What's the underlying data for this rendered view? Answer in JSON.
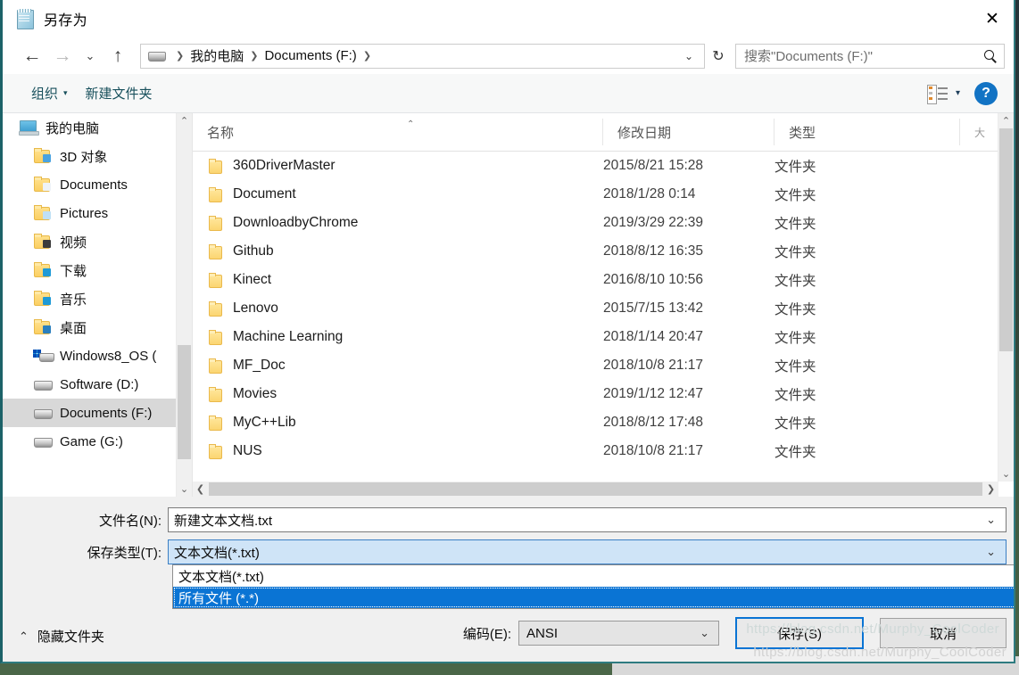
{
  "window": {
    "title": "另存为",
    "title_icon": "notepad-icon",
    "close_label": "✕"
  },
  "nav": {
    "back_label": "←",
    "forward_label": "→",
    "recent_label": "⌄",
    "up_label": "↑",
    "refresh_label": "↻",
    "breadcrumb": {
      "drive_icon": "drive-icon",
      "separator": "❯",
      "items": [
        "我的电脑",
        "Documents (F:)"
      ],
      "caret": "⌄"
    }
  },
  "search": {
    "placeholder": "搜索\"Documents (F:)\"",
    "icon": "search-icon"
  },
  "toolbar": {
    "organize_label": "组织",
    "organize_caret": "▾",
    "new_folder_label": "新建文件夹",
    "view_icon": "list-view-icon",
    "view_caret": "▾",
    "help_label": "?"
  },
  "sidebar": {
    "items": [
      {
        "label": "我的电脑",
        "icon": "computer-icon",
        "indent": false,
        "selected": false
      },
      {
        "label": "3D 对象",
        "icon": "folder-3d-icon",
        "indent": true,
        "selected": false
      },
      {
        "label": "Documents",
        "icon": "folder-documents-icon",
        "indent": true,
        "selected": false
      },
      {
        "label": "Pictures",
        "icon": "folder-pictures-icon",
        "indent": true,
        "selected": false
      },
      {
        "label": "视频",
        "icon": "folder-videos-icon",
        "indent": true,
        "selected": false
      },
      {
        "label": "下载",
        "icon": "folder-downloads-icon",
        "indent": true,
        "selected": false
      },
      {
        "label": "音乐",
        "icon": "folder-music-icon",
        "indent": true,
        "selected": false
      },
      {
        "label": "桌面",
        "icon": "folder-desktop-icon",
        "indent": true,
        "selected": false
      },
      {
        "label": "Windows8_OS (",
        "icon": "windows-drive-icon",
        "indent": true,
        "selected": false
      },
      {
        "label": "Software (D:)",
        "icon": "drive-icon",
        "indent": true,
        "selected": false
      },
      {
        "label": "Documents (F:)",
        "icon": "drive-icon",
        "indent": true,
        "selected": true
      },
      {
        "label": "Game (G:)",
        "icon": "drive-icon",
        "indent": true,
        "selected": false
      }
    ],
    "scroll_up": "⌃",
    "scroll_down": "⌄"
  },
  "filelist": {
    "columns": [
      "名称",
      "修改日期",
      "类型",
      "大"
    ],
    "sort_indicator": "⌃",
    "rows": [
      {
        "name": "360DriverMaster",
        "date": "2015/8/21 15:28",
        "type": "文件夹"
      },
      {
        "name": "Document",
        "date": "2018/1/28 0:14",
        "type": "文件夹"
      },
      {
        "name": "DownloadbyChrome",
        "date": "2019/3/29 22:39",
        "type": "文件夹"
      },
      {
        "name": "Github",
        "date": "2018/8/12 16:35",
        "type": "文件夹"
      },
      {
        "name": "Kinect",
        "date": "2016/8/10 10:56",
        "type": "文件夹"
      },
      {
        "name": "Lenovo",
        "date": "2015/7/15 13:42",
        "type": "文件夹"
      },
      {
        "name": "Machine Learning",
        "date": "2018/1/14 20:47",
        "type": "文件夹"
      },
      {
        "name": "MF_Doc",
        "date": "2018/10/8 21:17",
        "type": "文件夹"
      },
      {
        "name": "Movies",
        "date": "2019/1/12 12:47",
        "type": "文件夹"
      },
      {
        "name": "MyC++Lib",
        "date": "2018/8/12 17:48",
        "type": "文件夹"
      },
      {
        "name": "NUS",
        "date": "2018/10/8 21:17",
        "type": "文件夹"
      }
    ],
    "hscroll_left": "❮",
    "hscroll_right": "❯",
    "vscroll_up": "⌃",
    "vscroll_down": "⌄"
  },
  "form": {
    "filename_label": "文件名(N):",
    "filename_value": "新建文本文档.txt",
    "filename_caret": "⌄",
    "filetype_label": "保存类型(T):",
    "filetype_value": "文本文档(*.txt)",
    "filetype_caret": "⌄",
    "filetype_options": [
      {
        "label": "文本文档(*.txt)",
        "highlighted": false
      },
      {
        "label": "所有文件  (*.*)",
        "highlighted": true
      }
    ]
  },
  "footer": {
    "hide_folders_caret": "⌃",
    "hide_folders_label": "隐藏文件夹",
    "encoding_label": "编码(E):",
    "encoding_value": "ANSI",
    "encoding_caret": "⌄",
    "save_label": "保存(S)",
    "cancel_label": "取消"
  },
  "watermark": {
    "text": "https://blog.csdn.net/Murphy_CoolCoder"
  },
  "colors": {
    "window_border": "#2e7b80",
    "accent_blue": "#0a74d4",
    "highlight_bg": "#cfe4f7",
    "toolbar_text": "#18505c",
    "selected_row": "#d8d8d8"
  }
}
